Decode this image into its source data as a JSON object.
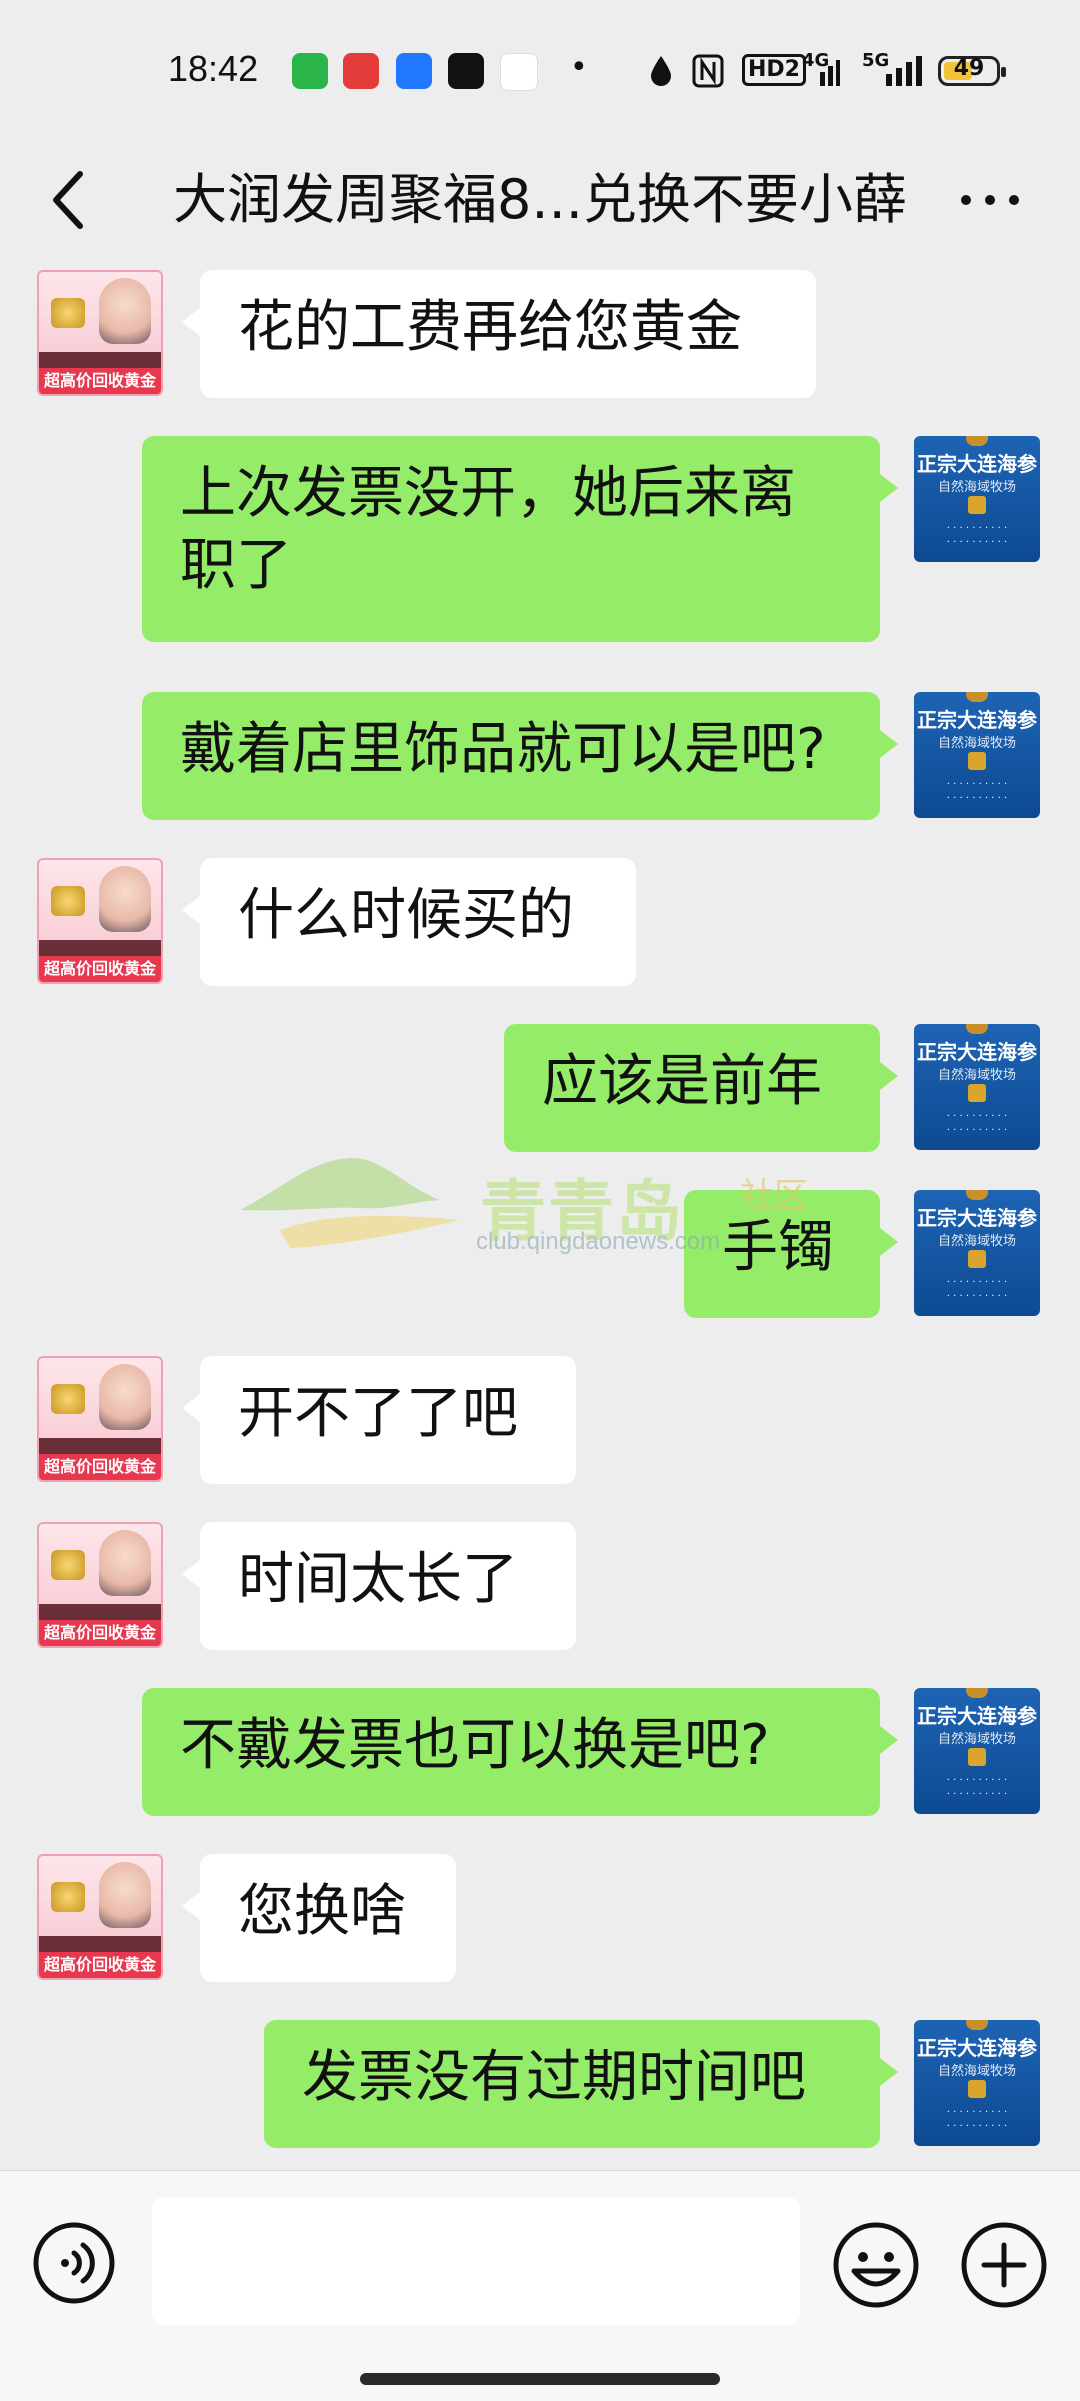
{
  "status_bar": {
    "time": "18:42",
    "network": "4G",
    "network2": "5G",
    "hd": "HD2",
    "battery": "49",
    "battery_color": "#f2c43a"
  },
  "header": {
    "title": "大润发周聚福8...兑换不要小薛",
    "back_icon": "chevron-left-icon",
    "more_icon": "more-dots-icon"
  },
  "avatars": {
    "left_caption": "超高价回收黄金",
    "right_title": "正宗大连海参",
    "right_subtitle": "自然海域牧场"
  },
  "messages": [
    {
      "side": "left",
      "text": "花的工费再给您黄金"
    },
    {
      "side": "right",
      "text": "上次发票没开，她后来离",
      "text2": "职了"
    },
    {
      "side": "right",
      "text": "戴着店里饰品就可以是吧?"
    },
    {
      "side": "left",
      "text": "什么时候买的"
    },
    {
      "side": "right",
      "text": "应该是前年"
    },
    {
      "side": "right",
      "text": "手镯"
    },
    {
      "side": "left",
      "text": "开不了了吧"
    },
    {
      "side": "left",
      "text": "时间太长了"
    },
    {
      "side": "right",
      "text": "不戴发票也可以换是吧?"
    },
    {
      "side": "left",
      "text": "您换啥"
    },
    {
      "side": "right",
      "text": "发票没有过期时间吧"
    }
  ],
  "watermark": {
    "name": "青青岛",
    "tag": "社区",
    "url": "club.qingdaonews.com"
  },
  "input_bar": {
    "voice_icon": "voice-icon",
    "emoji_icon": "emoji-icon",
    "plus_icon": "plus-icon"
  },
  "colors": {
    "sent_bubble": "#95ec69",
    "received_bubble": "#ffffff",
    "background": "#ededed"
  }
}
